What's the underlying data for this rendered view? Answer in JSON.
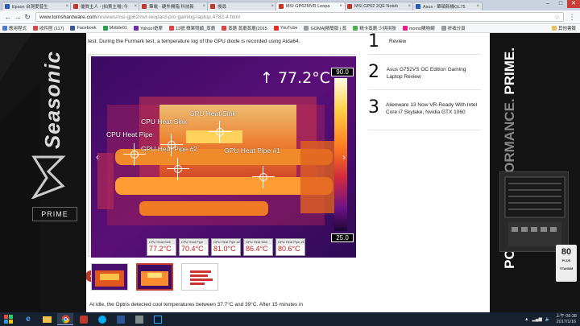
{
  "browser": {
    "tabs": [
      {
        "label": "Epson 台灣愛普生",
        "color": "#2a5db0",
        "active": false
      },
      {
        "label": "優質主人 - |拍賣主場| 今",
        "color": "#c0392b",
        "active": false
      },
      {
        "label": "筆電 - 硬件開箱 科技新",
        "color": "#c0392b",
        "active": false
      },
      {
        "label": "搜尋",
        "color": "#c0392b",
        "active": false
      },
      {
        "label": "MSI GP62MVR Leopa",
        "color": "#c0392b",
        "active": true
      },
      {
        "label": "MSI GP62 2QE Noteb",
        "color": "#c0392b",
        "active": false
      },
      {
        "label": "Asus - 華碩新機GL75",
        "color": "#2a5db0",
        "active": false
      }
    ],
    "url_host": "www.tomshardware.com",
    "url_path": "/reviews/msi-gp62mvr-leopard-pro-gaming-laptop,4782-4.html",
    "bookmarks": [
      {
        "label": "應用程式",
        "color": "#4a7bd0"
      },
      {
        "label": "收件匣 (117)",
        "color": "#d44"
      },
      {
        "label": "Facebook",
        "color": "#3b5998"
      },
      {
        "label": "Mobile01",
        "color": "#2a9d4a"
      },
      {
        "label": "Yahoo!奇摩",
        "color": "#6b2fa5"
      },
      {
        "label": "13號 蘋果照顧_蒸蘑",
        "color": "#d44"
      },
      {
        "label": "蒸蘑 蒸蘑蒸蘑(2015",
        "color": "#d44"
      },
      {
        "label": "YouTube",
        "color": "#e52d27"
      },
      {
        "label": "GOMA[精簡版 | 蒸",
        "color": "#999"
      },
      {
        "label": "精卡蒸蘑 少拼拼肢",
        "color": "#4caf50"
      },
      {
        "label": "momo購物網",
        "color": "#e91e8c"
      },
      {
        "label": "祈禱分頁",
        "color": "#999"
      }
    ],
    "bookmarks_other": "其他書籤"
  },
  "article": {
    "top_text": "test. During the Furmark test, a temperature log of the GPU diode is recorded using Aida64.",
    "thermal": {
      "max_temp": "↑ 77.2°C",
      "scale_max": "90.0",
      "scale_min": "25.0",
      "labels": {
        "gpu_heat_sink_1": "GPU Heat Sink",
        "cpu_heat_sink": "CPU Heat Sink",
        "cpu_heat_pipe": "CPU Heat Pipe",
        "gpu_heat_pipe_2": "GPU Heat Pipe #2",
        "gpu_heat_pipe_1": "GPU Heat Pipe #1"
      },
      "readouts": [
        {
          "name": "CPU Heat Sink",
          "value": "77.2°C"
        },
        {
          "name": "CPU Heat Pipe",
          "value": "70.4°C"
        },
        {
          "name": "GPU Heat Pipe #2",
          "value": "81.0°C"
        },
        {
          "name": "GPU Heat Sink",
          "value": "86.4°C"
        },
        {
          "name": "GPU Heat Pipe #1",
          "value": "80.6°C"
        }
      ]
    },
    "bottom_text": "At idle, the Optris detected cool temperatures between 37.7°C and 39°C. After 15 minutes in"
  },
  "sidebar": {
    "items": [
      {
        "num": "1",
        "title": "Review"
      },
      {
        "num": "2",
        "title": "Asus G752VS OC Edition Gaming Laptop Review"
      },
      {
        "num": "3",
        "title": "Alienware 13 Now VR-Ready With Intel Core i7 Skylake, Nvidia GTX 1060"
      }
    ]
  },
  "ads": {
    "left_brand": "Seasonic",
    "left_line": "PRIME",
    "right_line1": "POWER.",
    "right_line2": "PERFORMANCE.",
    "right_line3": "PRIME.",
    "badge_top": "80",
    "badge_mid": "PLUS",
    "badge_bottom": "TITANIUM"
  },
  "taskbar": {
    "time": "上午 09:38",
    "date": "2017/1/16"
  }
}
